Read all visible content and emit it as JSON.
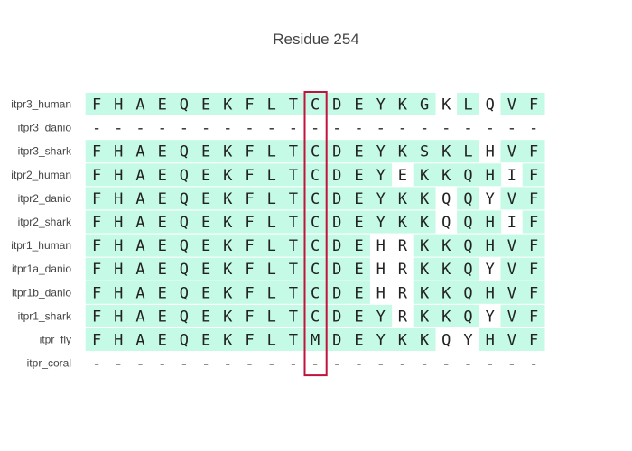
{
  "chart_data": {
    "type": "table",
    "title": "Residue 254",
    "highlight_color": "#c4fae6",
    "box_color": "#c0143c",
    "highlight_column": 11,
    "rows": [
      {
        "label": "itpr3_human",
        "seq": "FHAEQEKFLTCDEYKGKLQVF",
        "hl": "111111111111111101011"
      },
      {
        "label": "itpr3_danio",
        "seq": "---------------------",
        "hl": "000000000000000000000"
      },
      {
        "label": "itpr3_shark",
        "seq": "FHAEQEKFLTCDEYKSKLHVF",
        "hl": "111111111111111111011"
      },
      {
        "label": "itpr2_human",
        "seq": "FHAEQEKFLTCDEYEKKQHIF",
        "hl": "111111111111110111101"
      },
      {
        "label": "itpr2_danio",
        "seq": "FHAEQEKFLTCDEYKKQQYVF",
        "hl": "111111111111111101011"
      },
      {
        "label": "itpr2_shark",
        "seq": "FHAEQEKFLTCDEYKKQQHIF",
        "hl": "111111111111111101101"
      },
      {
        "label": "itpr1_human",
        "seq": "FHAEQEKFLTCDEHRKKQHVF",
        "hl": "111111111111100111111"
      },
      {
        "label": "itpr1a_danio",
        "seq": "FHAEQEKFLTCDEHRKKQYVF",
        "hl": "111111111111100111011"
      },
      {
        "label": "itpr1b_danio",
        "seq": "FHAEQEKFLTCDEHRKKQHVF",
        "hl": "111111111111100111111"
      },
      {
        "label": "itpr1_shark",
        "seq": "FHAEQEKFLTCDEYRKKQYVF",
        "hl": "111111111111110111011"
      },
      {
        "label": "itpr_fly",
        "seq": "FHAEQEKFLTMDEYKKQYHVF",
        "hl": "111111111111111100111"
      },
      {
        "label": "itpr_coral",
        "seq": "---------------------",
        "hl": "000000000000000000000"
      }
    ]
  }
}
